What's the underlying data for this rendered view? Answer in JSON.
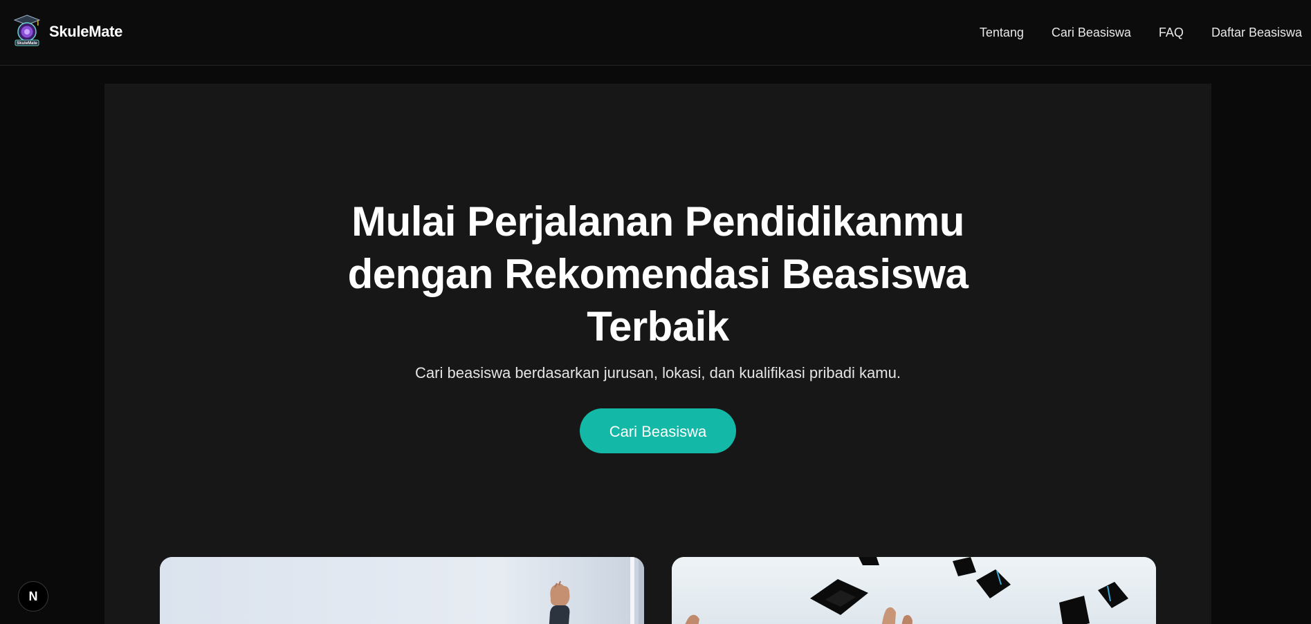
{
  "brand": {
    "name": "SkuleMate",
    "logo_icon": "graduation-cap-logo-icon",
    "logo_text": "SkuleMate"
  },
  "nav": {
    "items": [
      {
        "label": "Tentang"
      },
      {
        "label": "Cari Beasiswa"
      },
      {
        "label": "FAQ"
      },
      {
        "label": "Daftar Beasiswa"
      }
    ]
  },
  "hero": {
    "title_lines": [
      "Mulai Perjalanan Pendidikanmu",
      "dengan Rekomendasi Beasiswa",
      "Terbaik"
    ],
    "subtitle": "Cari beasiswa berdasarkan jurusan, lokasi, dan kualifikasi pribadi kamu.",
    "cta_label": "Cari Beasiswa"
  },
  "gallery": {
    "images": [
      {
        "icon": "student-raising-fist-photo"
      },
      {
        "icon": "graduation-caps-thrown-photo"
      }
    ]
  },
  "dev_badge": {
    "label": "N",
    "icon": "nextjs-dev-indicator-icon"
  },
  "colors": {
    "page_background": "#0a0a0a",
    "navbar_background": "#0c0c0c",
    "hero_background": "#171717",
    "accent": "#14b8a6",
    "text": "#ffffff"
  }
}
